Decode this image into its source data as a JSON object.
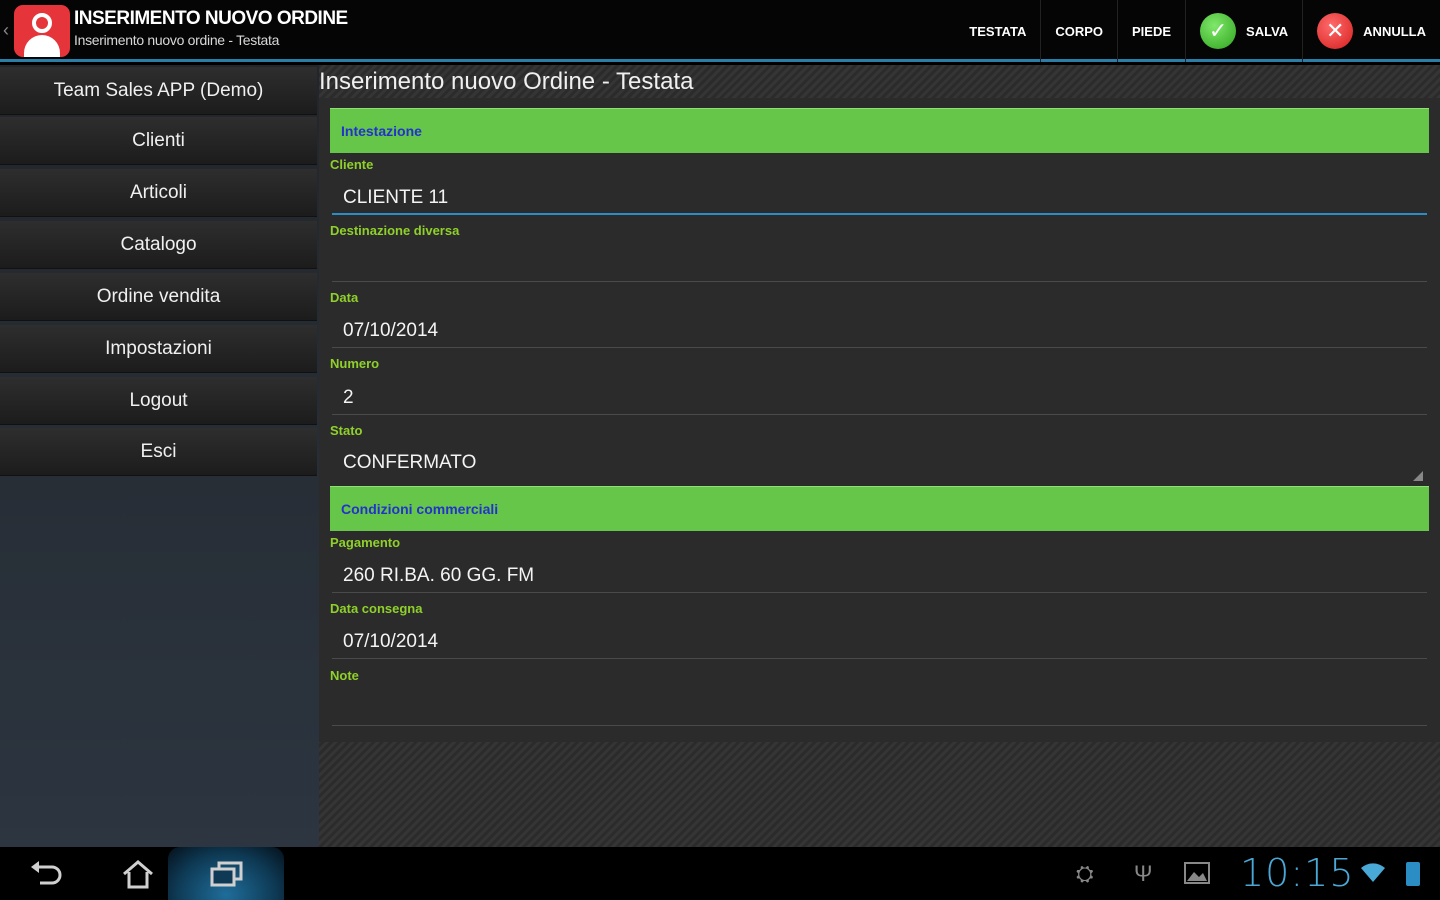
{
  "actionbar": {
    "back": "‹",
    "title": "INSERIMENTO NUOVO ORDINE",
    "subtitle": "Inserimento nuovo ordine - Testata",
    "actions": {
      "testata": "TESTATA",
      "corpo": "CORPO",
      "piede": "PIEDE",
      "salva": "SALVA",
      "annulla": "ANNULLA"
    }
  },
  "sidebar": {
    "items": [
      {
        "label": "Team Sales APP (Demo)"
      },
      {
        "label": "Clienti"
      },
      {
        "label": "Articoli"
      },
      {
        "label": "Catalogo"
      },
      {
        "label": "Ordine vendita"
      },
      {
        "label": "Impostazioni"
      },
      {
        "label": "Logout"
      },
      {
        "label": "Esci"
      }
    ]
  },
  "main": {
    "title": "Inserimento nuovo Ordine - Testata",
    "sections": {
      "intestazione": "Intestazione",
      "condizioni": "Condizioni commerciali"
    },
    "fields": {
      "cliente": {
        "label": "Cliente",
        "value": "CLIENTE 11"
      },
      "destinazione": {
        "label": "Destinazione diversa",
        "value": ""
      },
      "data": {
        "label": "Data",
        "value": "07/10/2014"
      },
      "numero": {
        "label": "Numero",
        "value": "2"
      },
      "stato": {
        "label": "Stato",
        "value": "CONFERMATO"
      },
      "pagamento": {
        "label": "Pagamento",
        "value": "260  RI.BA. 60 GG. FM"
      },
      "data_consegna": {
        "label": "Data consegna",
        "value": "07/10/2014"
      },
      "note": {
        "label": "Note",
        "value": ""
      }
    }
  },
  "systembar": {
    "clock": "10:15"
  },
  "colors": {
    "accent": "#2a8ec4",
    "section_green": "#66c64a",
    "label_green": "#8fd12a",
    "section_text": "#2233cc"
  }
}
